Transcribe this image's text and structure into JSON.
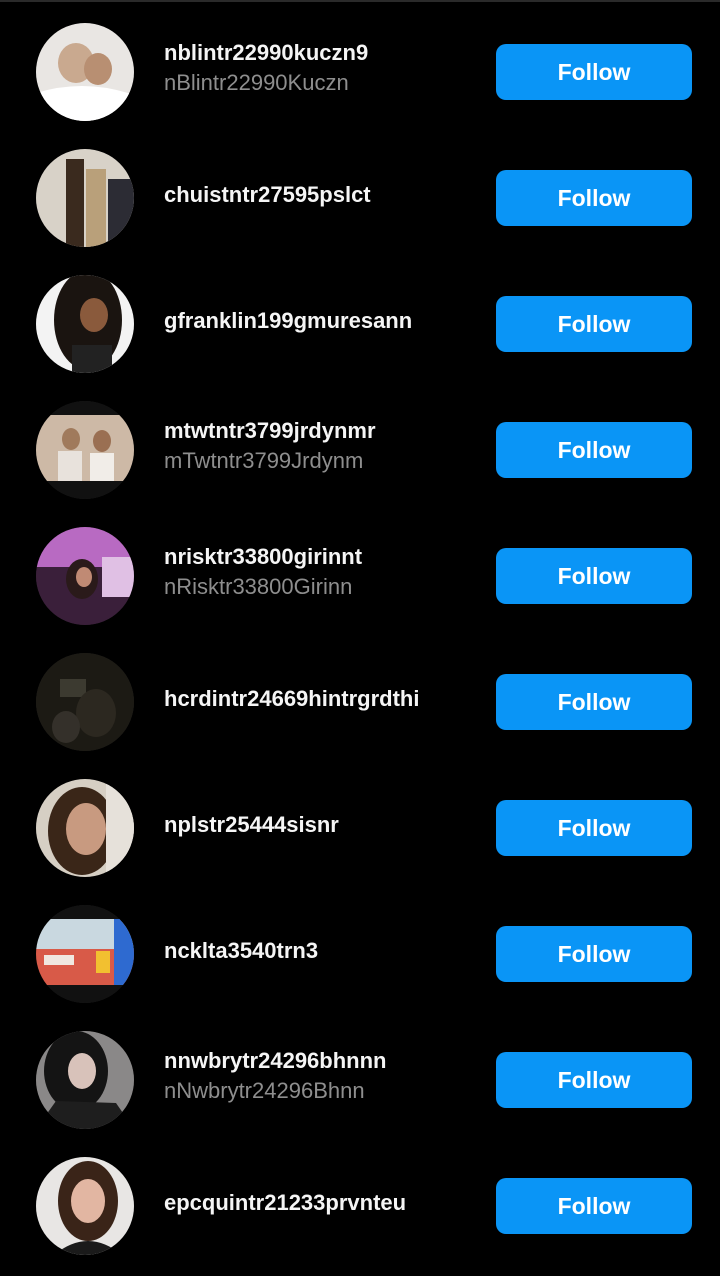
{
  "suggestions": [
    {
      "username": "nblintr22990kuczn9",
      "full_name": "nBlintr22990Kuczn",
      "button": "Follow"
    },
    {
      "username": "chuistntr27595pslct",
      "full_name": "",
      "button": "Follow"
    },
    {
      "username": "gfranklin199gmuresann",
      "full_name": "",
      "button": "Follow"
    },
    {
      "username": "mtwtntr3799jrdynmr",
      "full_name": "mTwtntr3799Jrdynm",
      "button": "Follow"
    },
    {
      "username": "nrisktr33800girinnt",
      "full_name": "nRisktr33800Girinn",
      "button": "Follow"
    },
    {
      "username": "hcrdintr24669hintrgrdthi",
      "full_name": "",
      "button": "Follow"
    },
    {
      "username": "nplstr25444sisnr",
      "full_name": "",
      "button": "Follow"
    },
    {
      "username": "ncklta3540trn3",
      "full_name": "",
      "button": "Follow"
    },
    {
      "username": "nnwbrytr24296bhnnn",
      "full_name": "nNwbrytr24296Bhnn",
      "button": "Follow"
    },
    {
      "username": "epcquintr21233prvnteu",
      "full_name": "",
      "button": "Follow"
    }
  ],
  "colors": {
    "background": "#000000",
    "follow_button": "#0a95f6",
    "username": "#f5f5f5",
    "full_name": "#8e8e8e"
  }
}
